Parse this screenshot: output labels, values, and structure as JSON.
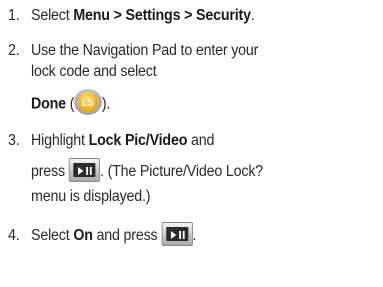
{
  "steps": [
    {
      "num": "1.",
      "lines": [
        {
          "a": "Select ",
          "menu": "Menu",
          "sep1": " > ",
          "settings": "Settings",
          "sep2": " > ",
          "security": "Security",
          "end": "."
        }
      ]
    },
    {
      "num": "2.",
      "text1": "Use the Navigation Pad to enter your",
      "text2": "lock code and select",
      "done_label": "Done",
      "done_open": " (",
      "done_close": ")."
    },
    {
      "num": "3.",
      "text1_a": "Highlight ",
      "text1_b": "Lock Pic/Video",
      "text1_c": " and",
      "text2_a": "press ",
      "text2_b": ". (The Picture/Video Lock?",
      "text3": "menu is displayed.)"
    },
    {
      "num": "4.",
      "text_a": "Select ",
      "on_label": "On",
      "text_b": " and press ",
      "text_c": "."
    }
  ],
  "icons": {
    "ls_key": "LS",
    "play_key": "play-pause-icon"
  },
  "colors": {
    "text": "#2a2a2a",
    "ls_orange": "#f7b124",
    "key_dark": "#2b2b2b"
  }
}
